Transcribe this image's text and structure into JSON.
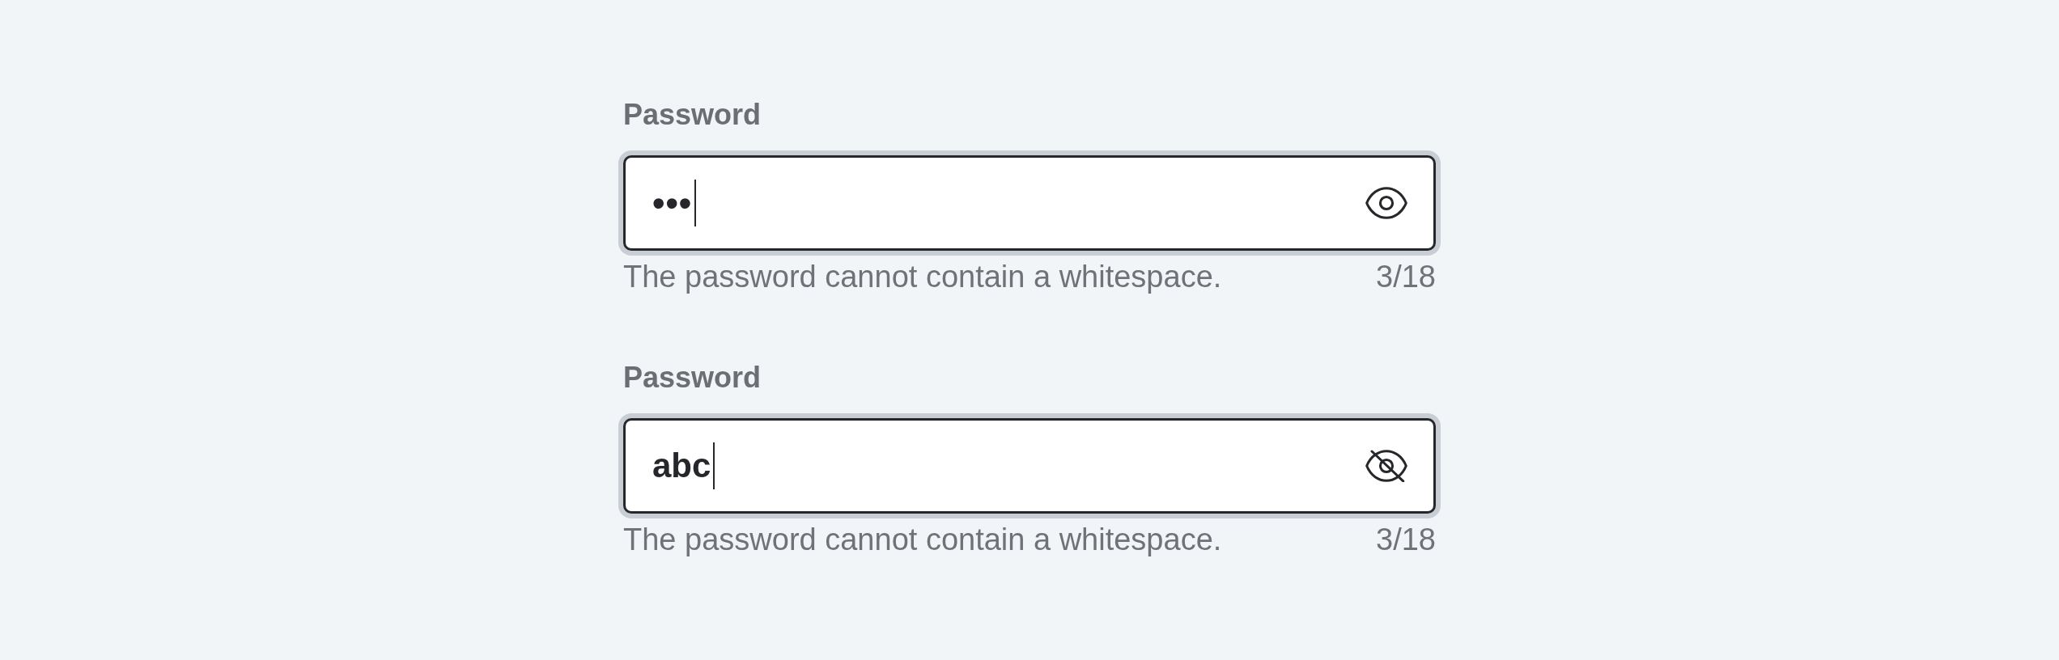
{
  "fields": [
    {
      "label": "Password",
      "value": "•••",
      "password_visible": false,
      "focused": true,
      "helper": "The password cannot contain a whitespace.",
      "counter": "3/18"
    },
    {
      "label": "Password",
      "value": "abc",
      "password_visible": true,
      "focused": true,
      "helper": "The password cannot contain a whitespace.",
      "counter": "3/18"
    }
  ]
}
